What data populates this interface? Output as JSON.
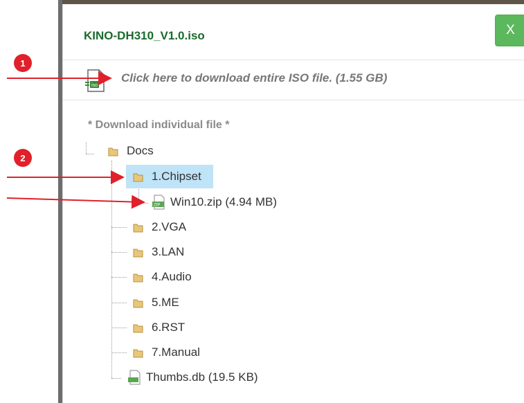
{
  "modal": {
    "title": "KINO-DH310_V1.0.iso",
    "close_label": "X",
    "download_link": "Click here to download entire ISO file. (1.55 GB)",
    "section_label": "* Download individual file *"
  },
  "tree": {
    "root": "Docs",
    "items": [
      {
        "label": "1.Chipset",
        "type": "folder",
        "selected": true
      },
      {
        "label": "Win10.zip (4.94 MB)",
        "type": "zip"
      },
      {
        "label": "2.VGA",
        "type": "folder"
      },
      {
        "label": "3.LAN",
        "type": "folder"
      },
      {
        "label": "4.Audio",
        "type": "folder"
      },
      {
        "label": "5.ME",
        "type": "folder"
      },
      {
        "label": "6.RST",
        "type": "folder"
      },
      {
        "label": "7.Manual",
        "type": "folder"
      },
      {
        "label": "Thumbs.db (19.5 KB)",
        "type": "file"
      }
    ]
  },
  "annotations": {
    "badge_1": "1",
    "badge_2": "2",
    "arrow_color": "#e0202a"
  },
  "colors": {
    "title": "#1a6b2d",
    "close_button": "#5cb85c",
    "selection": "#bfe3f7"
  }
}
